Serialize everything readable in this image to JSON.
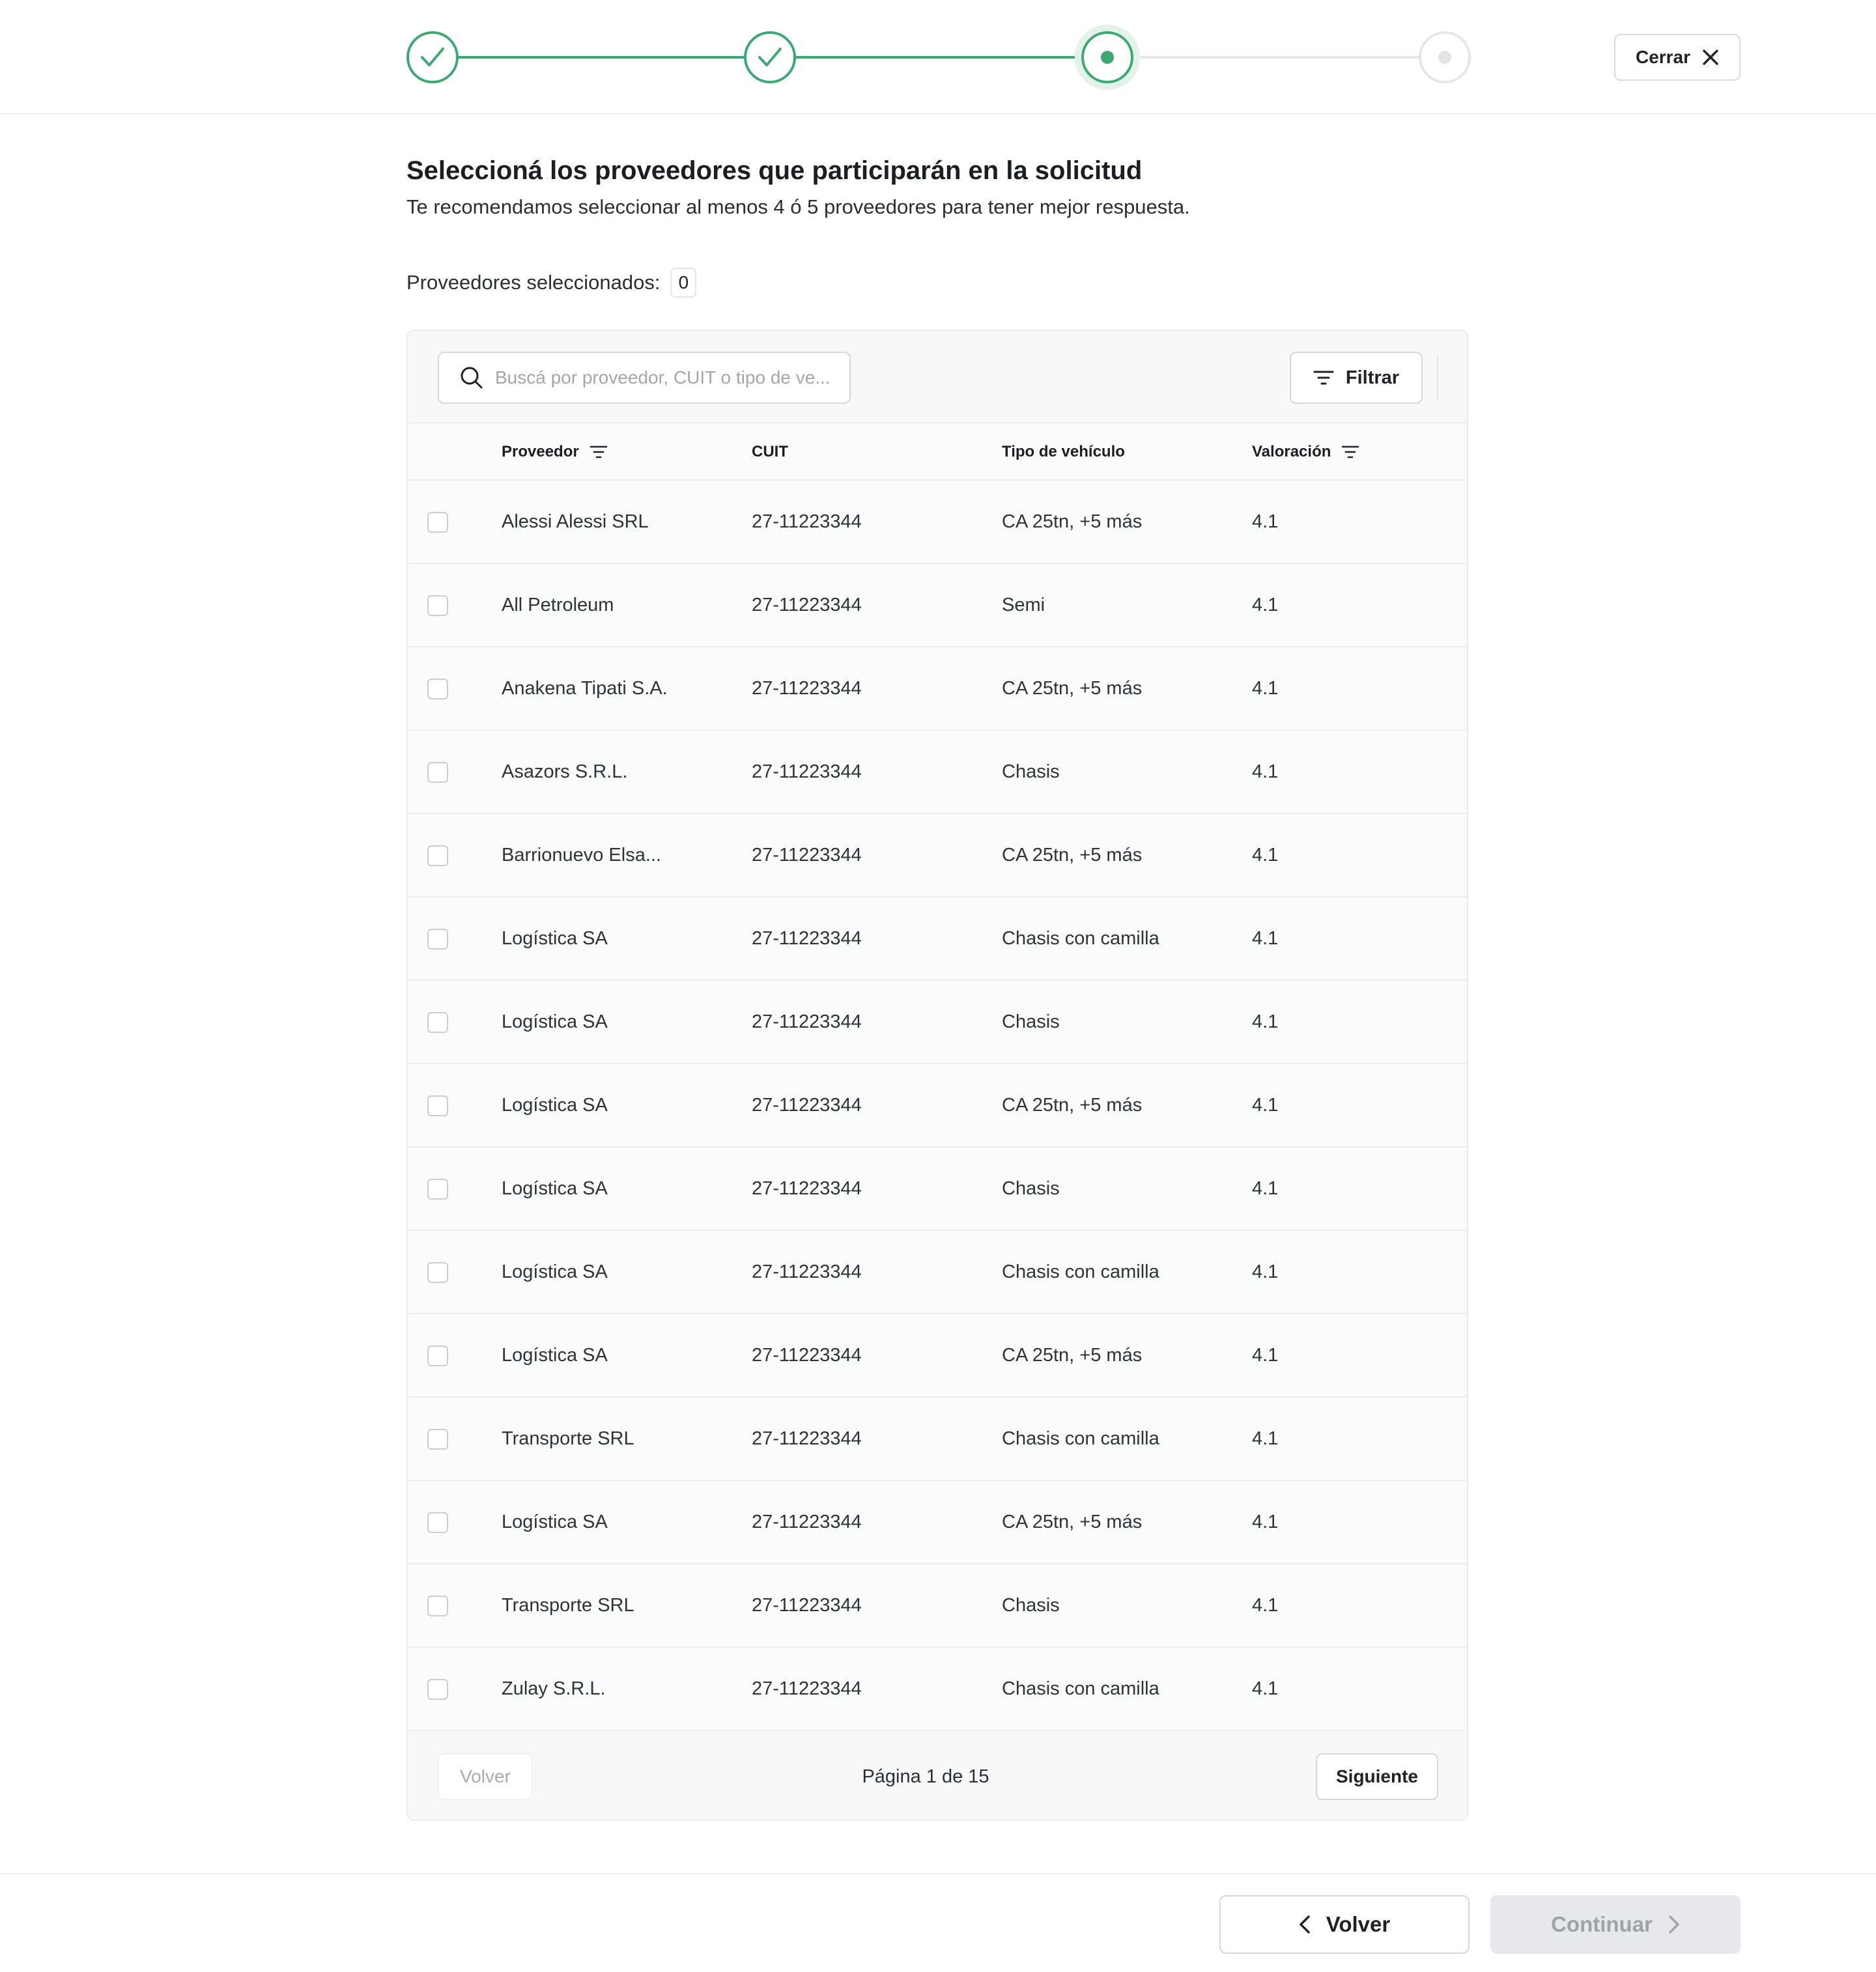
{
  "stepper": {
    "steps": [
      {
        "state": "done"
      },
      {
        "state": "done"
      },
      {
        "state": "current"
      },
      {
        "state": "todo"
      }
    ],
    "accent_color": "#3ea772"
  },
  "header": {
    "close_label": "Cerrar"
  },
  "page": {
    "title": "Seleccioná los proveedores que participarán en la solicitud",
    "subtitle": "Te recomendamos seleccionar al menos 4 ó 5 proveedores para tener mejor respuesta.",
    "selected_label": "Proveedores seleccionados:",
    "selected_count": "0"
  },
  "toolbar": {
    "search_placeholder": "Buscá por proveedor, CUIT o tipo de ve...",
    "filter_label": "Filtrar"
  },
  "table": {
    "columns": {
      "proveedor": "Proveedor",
      "cuit": "CUIT",
      "tipo": "Tipo de vehículo",
      "valoracion": "Valoración"
    },
    "rows": [
      {
        "proveedor": "Alessi Alessi SRL",
        "cuit": "27-11223344",
        "tipo": "CA 25tn, +5 más",
        "valoracion": "4.1"
      },
      {
        "proveedor": "All Petroleum",
        "cuit": "27-11223344",
        "tipo": "Semi",
        "valoracion": "4.1"
      },
      {
        "proveedor": "Anakena Tipati S.A.",
        "cuit": "27-11223344",
        "tipo": "CA 25tn, +5 más",
        "valoracion": "4.1"
      },
      {
        "proveedor": "Asazors S.R.L.",
        "cuit": "27-11223344",
        "tipo": "Chasis",
        "valoracion": "4.1"
      },
      {
        "proveedor": "Barrionuevo Elsa...",
        "cuit": "27-11223344",
        "tipo": "CA 25tn, +5 más",
        "valoracion": "4.1"
      },
      {
        "proveedor": "Logística SA",
        "cuit": "27-11223344",
        "tipo": "Chasis con camilla",
        "valoracion": "4.1"
      },
      {
        "proveedor": "Logística SA",
        "cuit": "27-11223344",
        "tipo": "Chasis",
        "valoracion": "4.1"
      },
      {
        "proveedor": "Logística SA",
        "cuit": "27-11223344",
        "tipo": "CA 25tn, +5 más",
        "valoracion": "4.1"
      },
      {
        "proveedor": "Logística SA",
        "cuit": "27-11223344",
        "tipo": "Chasis",
        "valoracion": "4.1"
      },
      {
        "proveedor": "Logística SA",
        "cuit": "27-11223344",
        "tipo": "Chasis con camilla",
        "valoracion": "4.1"
      },
      {
        "proveedor": "Logística SA",
        "cuit": "27-11223344",
        "tipo": "CA 25tn, +5 más",
        "valoracion": "4.1"
      },
      {
        "proveedor": "Transporte SRL",
        "cuit": "27-11223344",
        "tipo": "Chasis con camilla",
        "valoracion": "4.1"
      },
      {
        "proveedor": "Logística SA",
        "cuit": "27-11223344",
        "tipo": "CA 25tn, +5 más",
        "valoracion": "4.1"
      },
      {
        "proveedor": "Transporte SRL",
        "cuit": "27-11223344",
        "tipo": "Chasis",
        "valoracion": "4.1"
      },
      {
        "proveedor": "Zulay S.R.L.",
        "cuit": "27-11223344",
        "tipo": "Chasis con camilla",
        "valoracion": "4.1"
      }
    ]
  },
  "pagination": {
    "back_label": "Volver",
    "page_text": "Página 1 de 15",
    "next_label": "Siguiente"
  },
  "footer": {
    "back_label": "Volver",
    "continue_label": "Continuar"
  },
  "icons": {
    "step_done": "check-icon",
    "close": "close-icon",
    "search": "search-icon",
    "filter": "filter-icon",
    "sort": "sort-icon",
    "back": "chevron-left-icon",
    "forward": "chevron-right-icon"
  }
}
